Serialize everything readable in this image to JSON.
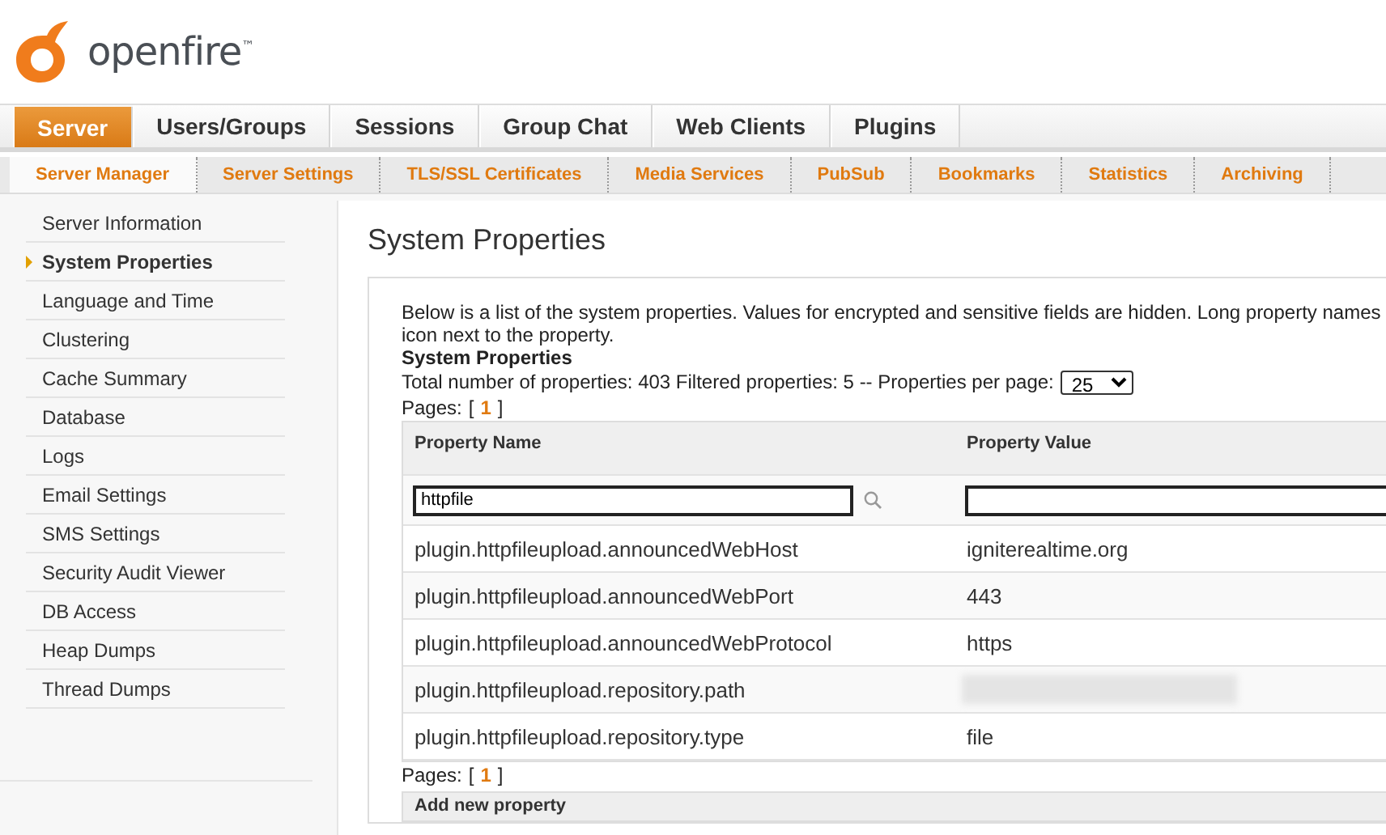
{
  "logo": {
    "text": "openfire",
    "mark": "™"
  },
  "main_tabs": [
    {
      "label": "Server",
      "selected": true
    },
    {
      "label": "Users/Groups",
      "selected": false
    },
    {
      "label": "Sessions",
      "selected": false
    },
    {
      "label": "Group Chat",
      "selected": false
    },
    {
      "label": "Web Clients",
      "selected": false
    },
    {
      "label": "Plugins",
      "selected": false
    }
  ],
  "sub_tabs": [
    {
      "label": "Server Manager",
      "selected": true
    },
    {
      "label": "Server Settings",
      "selected": false
    },
    {
      "label": "TLS/SSL Certificates",
      "selected": false
    },
    {
      "label": "Media Services",
      "selected": false
    },
    {
      "label": "PubSub",
      "selected": false
    },
    {
      "label": "Bookmarks",
      "selected": false
    },
    {
      "label": "Statistics",
      "selected": false
    },
    {
      "label": "Archiving",
      "selected": false
    }
  ],
  "sidebar": {
    "items": [
      {
        "label": "Server Information",
        "selected": false
      },
      {
        "label": "System Properties",
        "selected": true
      },
      {
        "label": "Language and Time",
        "selected": false
      },
      {
        "label": "Clustering",
        "selected": false
      },
      {
        "label": "Cache Summary",
        "selected": false
      },
      {
        "label": "Database",
        "selected": false
      },
      {
        "label": "Logs",
        "selected": false
      },
      {
        "label": "Email Settings",
        "selected": false
      },
      {
        "label": "SMS Settings",
        "selected": false
      },
      {
        "label": "Security Audit Viewer",
        "selected": false
      },
      {
        "label": "DB Access",
        "selected": false
      },
      {
        "label": "Heap Dumps",
        "selected": false
      },
      {
        "label": "Thread Dumps",
        "selected": false
      }
    ]
  },
  "page_title": "System Properties",
  "description": [
    "Below is a list of the system properties. Values for encrypted and sensitive fields are hidden. Long property names",
    "icon next to the property."
  ],
  "section_title": "System Properties",
  "totals": {
    "text": "Total number of properties: 403 Filtered properties: 5 -- Properties per page:",
    "per_page": "25"
  },
  "pager_top": {
    "label": "Pages:",
    "open": "[",
    "close": "]",
    "pages": [
      {
        "label": "1",
        "selected": true
      }
    ]
  },
  "table": {
    "columns": [
      "Property Name",
      "Property Value"
    ],
    "name_filter": {
      "value": "httpfile"
    },
    "rows": [
      {
        "name": "plugin.httpfileupload.announcedWebHost",
        "value": "igniterealtime.org",
        "hidden": false
      },
      {
        "name": "plugin.httpfileupload.announcedWebPort",
        "value": "443",
        "hidden": false
      },
      {
        "name": "plugin.httpfileupload.announcedWebProtocol",
        "value": "https",
        "hidden": false
      },
      {
        "name": "plugin.httpfileupload.repository.path",
        "value": "",
        "hidden": true
      },
      {
        "name": "plugin.httpfileupload.repository.type",
        "value": "file",
        "hidden": false
      }
    ]
  },
  "pager_bottom": {
    "label": "Pages:",
    "open": "[",
    "close": "]",
    "pages": [
      {
        "label": "1",
        "selected": true
      }
    ]
  },
  "add_section": {
    "title": "Add new property"
  }
}
